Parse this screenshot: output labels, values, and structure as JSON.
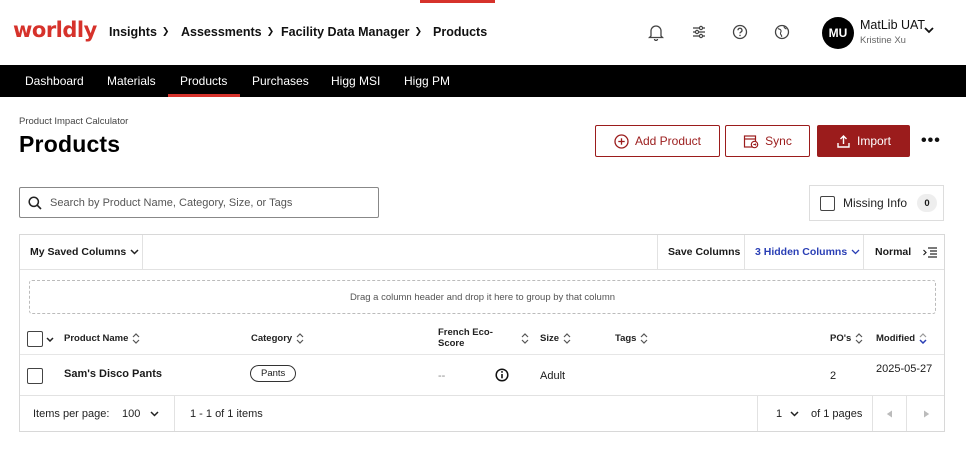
{
  "brand": {
    "logo_text": "worldly",
    "accent": "#d6322b",
    "primary": "#9b1c1c"
  },
  "top_menu": [
    {
      "label": "Insights",
      "has_dropdown": true
    },
    {
      "label": "Assessments",
      "has_dropdown": true
    },
    {
      "label": "Facility Data Manager",
      "has_dropdown": true
    },
    {
      "label": "Products",
      "has_dropdown": false,
      "active": true
    }
  ],
  "top_icons": [
    "bell-icon",
    "sliders-icon",
    "help-icon",
    "globe-icon"
  ],
  "user": {
    "initials": "MU",
    "name": "MatLib UAT",
    "subname": "Kristine Xu"
  },
  "sub_nav": [
    {
      "label": "Dashboard"
    },
    {
      "label": "Materials"
    },
    {
      "label": "Products",
      "active": true
    },
    {
      "label": "Purchases"
    },
    {
      "label": "Higg MSI"
    },
    {
      "label": "Higg PM"
    }
  ],
  "page": {
    "breadcrumb": "Product Impact Calculator",
    "title": "Products"
  },
  "actions": {
    "add_product": "Add Product",
    "sync": "Sync",
    "import": "Import",
    "more": "•••"
  },
  "search": {
    "placeholder": "Search by Product Name, Category, Size, or Tags",
    "value": ""
  },
  "missing_info": {
    "label": "Missing Info",
    "count": "0",
    "checked": false
  },
  "grid": {
    "toolbar": {
      "saved_columns": "My Saved Columns",
      "save_columns": "Save Columns",
      "hidden_columns": "3 Hidden Columns",
      "density": "Normal"
    },
    "group_hint": "Drag a column header and drop it here to group by that column",
    "columns": [
      {
        "key": "product_name",
        "label": "Product Name"
      },
      {
        "key": "category",
        "label": "Category"
      },
      {
        "key": "french_eco_score",
        "label": "French Eco-\nScore"
      },
      {
        "key": "size",
        "label": "Size"
      },
      {
        "key": "tags",
        "label": "Tags"
      },
      {
        "key": "pos",
        "label": "PO's"
      },
      {
        "key": "modified",
        "label": "Modified"
      }
    ],
    "rows": [
      {
        "product_name": "Sam's Disco Pants",
        "category": "Pants",
        "french_eco_score": "--",
        "size": "Adult",
        "tags": "",
        "pos": "2",
        "modified": "2025-05-27"
      }
    ],
    "pager": {
      "items_per_page_label": "Items per page:",
      "items_per_page": "100",
      "range": "1 - 1 of 1 items",
      "current_page": "1",
      "total_pages": "of 1 pages"
    }
  }
}
